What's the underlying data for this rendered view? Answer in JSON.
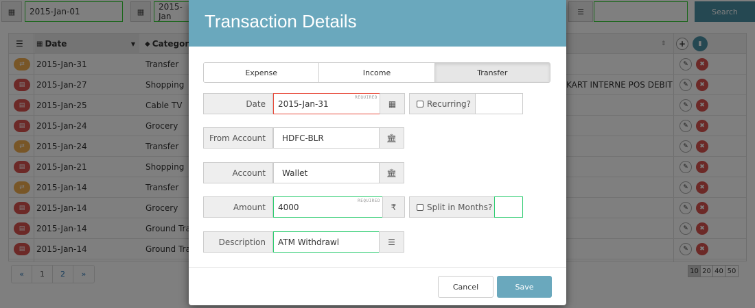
{
  "toolbar": {
    "from_date": "2015-Jan-01",
    "to_date": "2015-Jan",
    "search_label": "Search"
  },
  "grid": {
    "columns": {
      "date": "Date",
      "category": "Category"
    },
    "rows": [
      {
        "kind": "transfer",
        "date": "2015-Jan-31",
        "category": "Transfer"
      },
      {
        "kind": "expense",
        "date": "2015-Jan-27",
        "category": "Shopping"
      },
      {
        "kind": "expense",
        "date": "2015-Jan-25",
        "category": "Cable TV"
      },
      {
        "kind": "expense",
        "date": "2015-Jan-24",
        "category": "Grocery"
      },
      {
        "kind": "transfer",
        "date": "2015-Jan-24",
        "category": "Transfer"
      },
      {
        "kind": "expense",
        "date": "2015-Jan-21",
        "category": "Shopping"
      },
      {
        "kind": "transfer",
        "date": "2015-Jan-14",
        "category": "Transfer"
      },
      {
        "kind": "expense",
        "date": "2015-Jan-14",
        "category": "Grocery"
      },
      {
        "kind": "expense",
        "date": "2015-Jan-14",
        "category": "Ground Tra"
      },
      {
        "kind": "expense",
        "date": "2015-Jan-14",
        "category": "Ground Tra"
      }
    ],
    "row2_description": "KART INTERNE POS DEBIT"
  },
  "pager": {
    "prev": "«",
    "pages": [
      "1",
      "2"
    ],
    "next": "»"
  },
  "page_sizes": [
    "10",
    "20",
    "40",
    "50"
  ],
  "modal": {
    "title": "Transaction Details",
    "types": [
      "Expense",
      "Income",
      "Transfer"
    ],
    "active_type": "Transfer",
    "fields": {
      "date_label": "Date",
      "date_value": "2015-Jan-31",
      "required": "REQUIRED",
      "recurring_label": "Recurring?",
      "from_account_label": "From Account",
      "from_account_value": "HDFC-BLR",
      "account_label": "Account",
      "account_value": "Wallet",
      "amount_label": "Amount",
      "amount_value": "4000",
      "currency_symbol": "₹",
      "split_label": "Split in Months?",
      "description_label": "Description",
      "description_value": "ATM Withdrawl"
    },
    "cancel_label": "Cancel",
    "save_label": "Save"
  },
  "colors": {
    "header": "#6aa8bd",
    "save": "#6aa8bd",
    "search": "#4a90a4",
    "required_border": "#e74c3c",
    "valid_border": "#2ecc71",
    "transfer_icon": "#f0ad4e",
    "expense_icon": "#d9534f"
  }
}
